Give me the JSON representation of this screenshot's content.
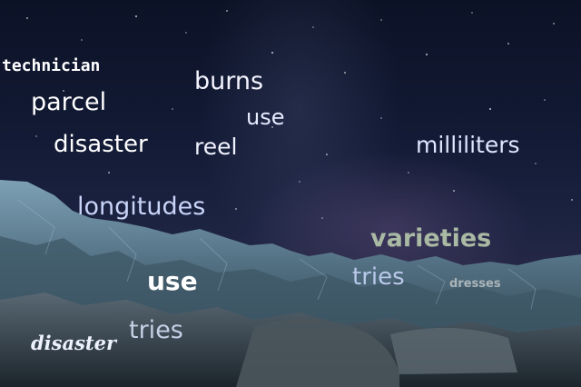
{
  "words": {
    "technician": "technician",
    "parcel": "parcel",
    "burns": "burns",
    "use_top": "use",
    "disaster_top": "disaster",
    "reel": "reel",
    "milliliters": "milliliters",
    "longitudes": "longitudes",
    "varieties": "varieties",
    "use_bottom": "use",
    "tries_right": "tries",
    "dresses": "dresses",
    "tries_left": "tries",
    "disaster_bottom": "disaster"
  },
  "colors": {
    "sky_top": "#0c1226",
    "sky_horizon": "#2a2a48",
    "ice": "#5f7e92",
    "ice_shadow": "#22323f"
  }
}
